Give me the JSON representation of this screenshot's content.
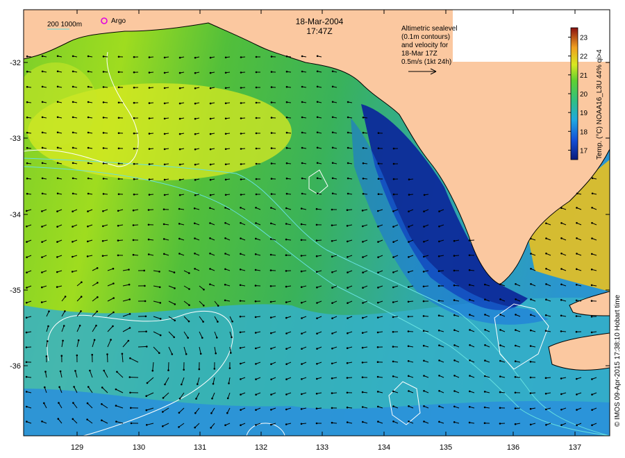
{
  "map": {
    "date": "18-Mar-2004",
    "time": "17:47Z",
    "scale_label": "200  1000m",
    "argo_label": "Argo",
    "info_lines": [
      "Altimetric sealevel",
      "(0.1m contours)",
      "and velocity for",
      "18-Mar 17Z",
      "0.5m/s (1kt 24h)"
    ],
    "credit": "© IMOS 09-Apr-2015 17:38:10 Hobart time",
    "lat_ticks": [
      "-32",
      "-33",
      "-34",
      "-35",
      "-36"
    ],
    "lon_ticks": [
      "129",
      "130",
      "131",
      "132",
      "133",
      "134",
      "135",
      "136",
      "137"
    ],
    "colorbar": {
      "title": "Temp. (°C) NOAA16_L3U 44% qi>4",
      "ticks": [
        "23",
        "22",
        "21",
        "20",
        "19",
        "18",
        "17"
      ],
      "min": 16.5,
      "max": 23.5
    },
    "colors": {
      "land": "#fbc8a0",
      "contour": "#ffffff",
      "bathymetry": "#66e0e0",
      "argo": "#e000e0"
    }
  }
}
